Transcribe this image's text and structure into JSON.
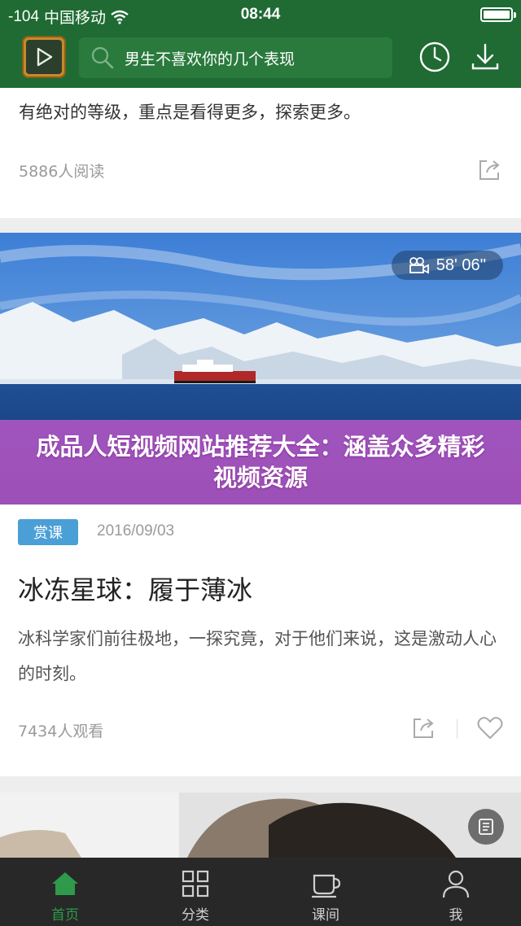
{
  "status_bar": {
    "signal": "-104",
    "carrier": "中国移动",
    "time": "08:44",
    "battery_level": 1.0
  },
  "header": {
    "logo_icon": "play-board-icon",
    "search_icon": "search-icon",
    "search_text": "男生不喜欢你的几个表现",
    "history_icon": "clock-icon",
    "download_icon": "download-icon"
  },
  "feed": {
    "card1": {
      "excerpt": "有绝对的等级，重点是看得更多，探索更多。",
      "reads": "5886人阅读",
      "share_icon": "share-icon"
    },
    "card2": {
      "duration": "58' 06''",
      "duration_icon": "video-camera-icon",
      "overlay_text": "成品人短视频网站推荐大全：涵盖众多精彩视频资源",
      "tag": "赏课",
      "date": "2016/09/03",
      "title": "冰冻星球：履于薄冰",
      "summary": "冰科学家们前往极地，一探究竟，对于他们来说，这是激动人心的时刻。",
      "views": "7434人观看",
      "share_icon": "share-icon",
      "like_icon": "heart-icon"
    },
    "card3": {
      "doc_icon": "document-icon"
    }
  },
  "tab_bar": {
    "tabs": [
      {
        "label": "首页",
        "icon": "home-icon",
        "active": true
      },
      {
        "label": "分类",
        "icon": "grid-icon",
        "active": false
      },
      {
        "label": "课间",
        "icon": "cup-icon",
        "active": false
      },
      {
        "label": "我",
        "icon": "person-icon",
        "active": false
      }
    ]
  },
  "colors": {
    "brand_green": "#1f6b33",
    "tag_blue": "#4a9fd6",
    "overlay_pink": "#d25ad2",
    "active_tab": "#2f9a4c"
  }
}
